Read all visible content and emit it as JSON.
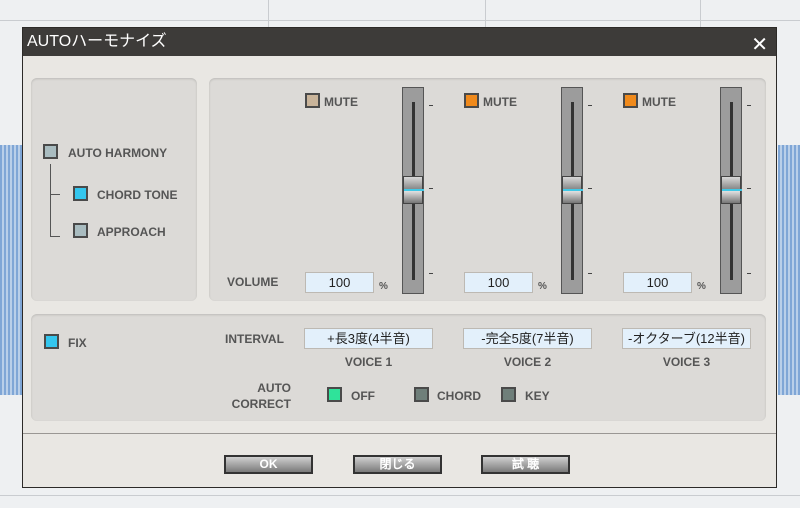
{
  "dialog": {
    "title": "AUTOハーモナイズ",
    "close_icon": "close-icon"
  },
  "harmony": {
    "auto_harmony": "AUTO HARMONY",
    "chord_tone": "CHORD TONE",
    "approach": "APPROACH",
    "chord_tone_checked": true
  },
  "volume_label": "VOLUME",
  "percent": "%",
  "mute_label": "MUTE",
  "voices": [
    {
      "name": "VOICE 1",
      "mute_color": "#c9b49a",
      "volume": "100",
      "interval": "+長3度(4半音)",
      "slider_level": 0.5
    },
    {
      "name": "VOICE 2",
      "mute_color": "#f08a1c",
      "volume": "100",
      "interval": "-完全5度(7半音)",
      "slider_level": 0.5
    },
    {
      "name": "VOICE 3",
      "mute_color": "#f08a1c",
      "volume": "100",
      "interval": "-オクターブ(12半音)",
      "slider_level": 0.5
    }
  ],
  "fix": {
    "label": "FIX",
    "checked": true
  },
  "interval_label": "INTERVAL",
  "auto_correct": {
    "label1": "AUTO",
    "label2": "CORRECT",
    "options": [
      "OFF",
      "CHORD",
      "KEY"
    ],
    "selected": "OFF"
  },
  "buttons": {
    "ok": "OK",
    "close": "閉じる",
    "audition": "試 聴"
  },
  "colors": {
    "active_cyan": "#34c6ee",
    "active_green": "#2fe39a",
    "inactive": "#a9bcc0"
  }
}
